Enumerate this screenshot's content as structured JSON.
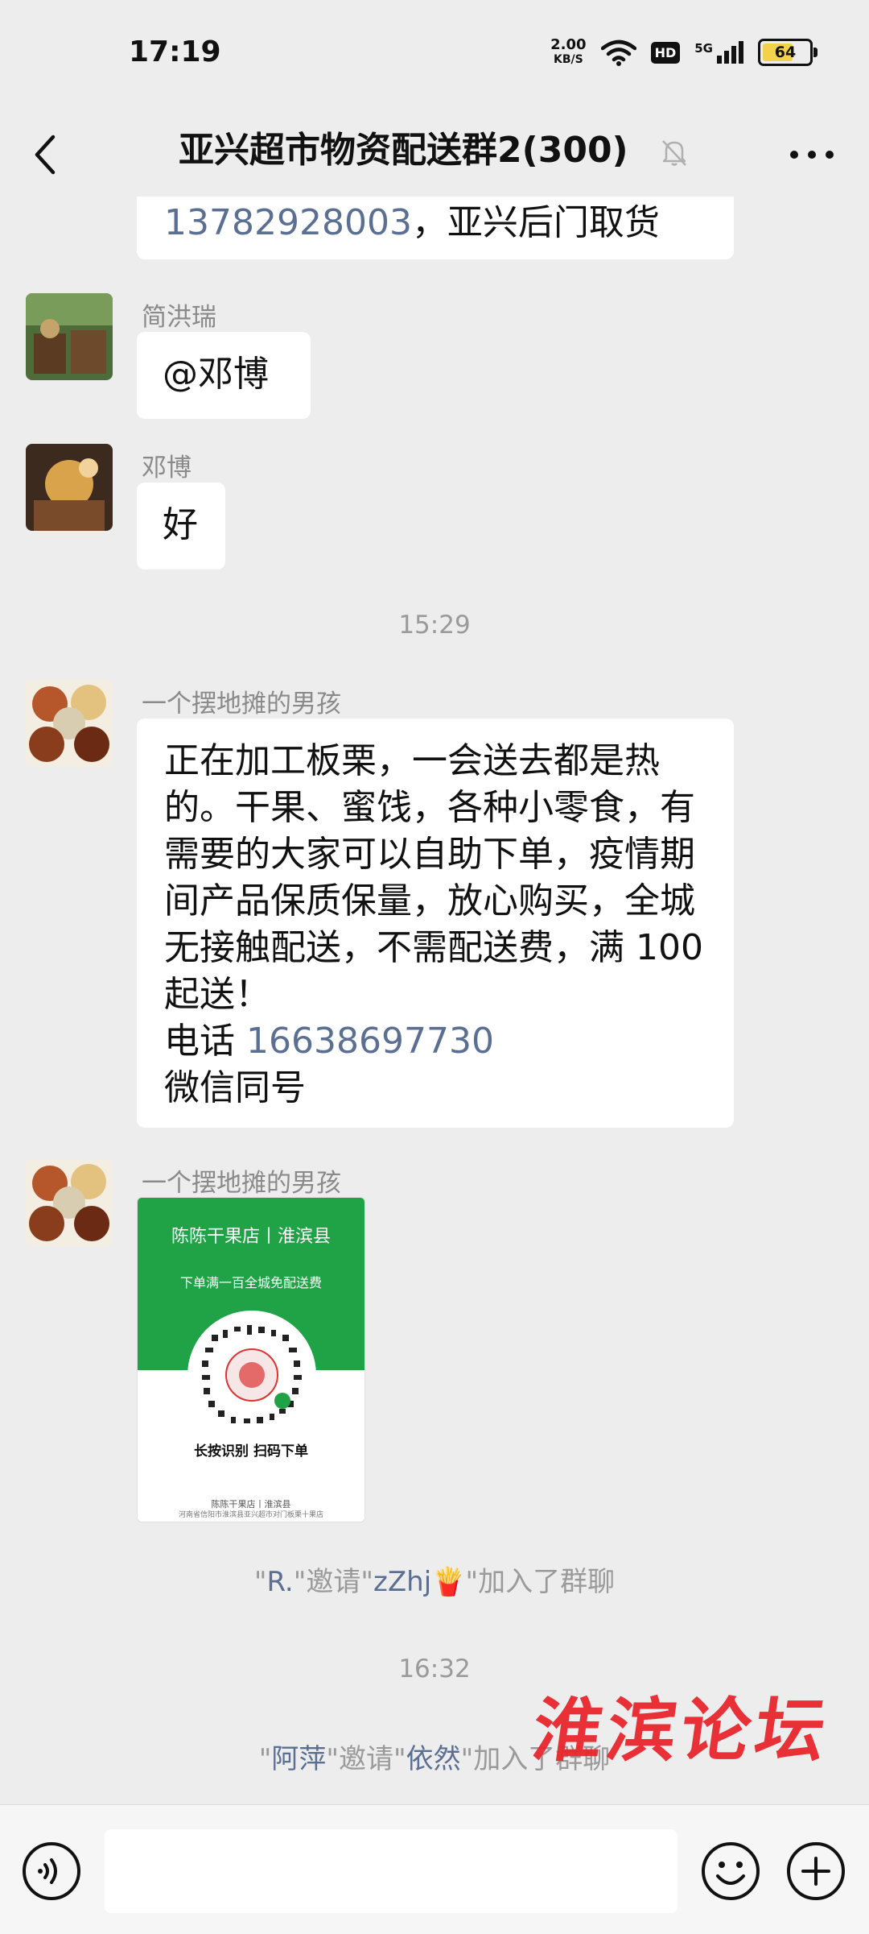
{
  "status": {
    "time": "17:19",
    "speed_value": "2.00",
    "speed_unit": "KB/S",
    "hd": "HD",
    "network": "5G",
    "battery": "64"
  },
  "nav": {
    "title": "亚兴超市物资配送群2(300)"
  },
  "messages": {
    "top_partial": {
      "phone": "13782928003",
      "text": "，亚兴后门取货"
    },
    "msg1": {
      "sender": "简洪瑞",
      "text": "@邓博"
    },
    "msg2": {
      "sender": "邓博",
      "text": "好"
    },
    "time1": "15:29",
    "msg3": {
      "sender": "一个摆地摊的男孩",
      "lines": [
        "正在加工板栗，一会送去都是热",
        "的。干果、蜜饯，各种小零食，有",
        "需要的大家可以自助下单，疫情期",
        "间产品保质保量，放心购买，全城",
        "无接触配送，不需配送费，满 100",
        "起送！"
      ],
      "phone_prefix": "电话 ",
      "phone": "16638697730",
      "last_line": "微信同号"
    },
    "msg4": {
      "sender": "一个摆地摊的男孩",
      "card_title": "陈陈干果店丨淮滨县",
      "card_sub": "下单满一百全城免配送费",
      "card_scan": "长按识别 扫码下单",
      "card_foot1": "陈陈干果店丨淮滨县",
      "card_foot2": "河南省信阳市淮滨县亚兴超市对门板栗十果店"
    },
    "sys1": {
      "q1": "\"",
      "inviter": "R.",
      "q2": "\"邀请\"",
      "invitee": "zZhj🍟",
      "q3": "\"加入了群聊"
    },
    "time2": "16:32",
    "sys2": {
      "q1": "\"",
      "inviter": "阿萍",
      "q2": "\"邀请\"",
      "invitee": "依然",
      "q3": "\"加入了群聊"
    }
  },
  "watermark": "淮滨论坛"
}
